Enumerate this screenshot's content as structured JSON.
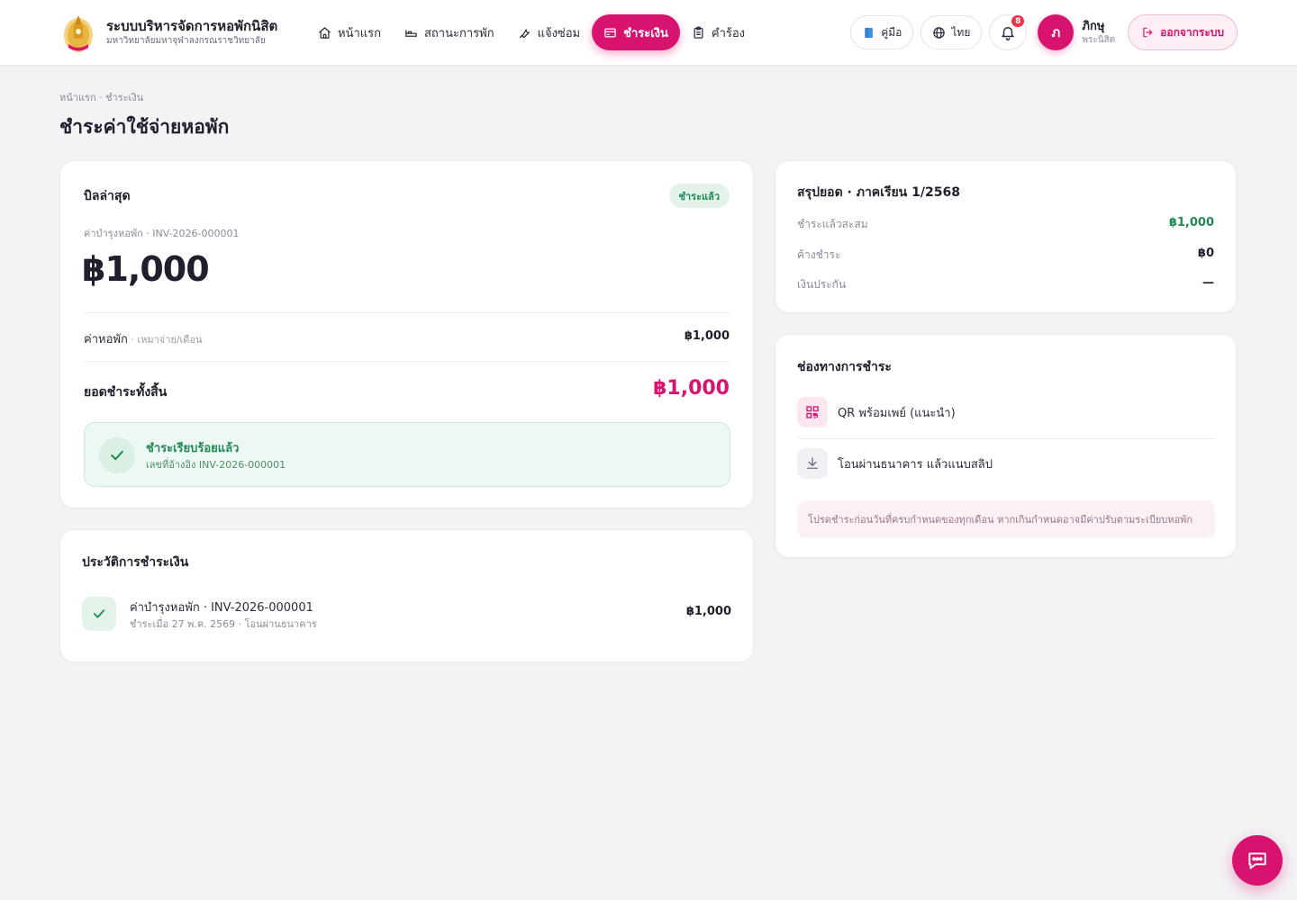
{
  "brand": {
    "title": "ระบบบริหารจัดการหอพักนิสิต",
    "subtitle": "มหาวิทยาลัยมหาจุฬาลงกรณราชวิทยาลัย"
  },
  "nav": {
    "items": [
      {
        "label": "หน้าแรก",
        "icon": "home-icon"
      },
      {
        "label": "สถานะการพัก",
        "icon": "bed-icon"
      },
      {
        "label": "แจ้งซ่อม",
        "icon": "wrench-icon"
      },
      {
        "label": "ชำระเงิน",
        "icon": "card-icon",
        "active": true
      },
      {
        "label": "คำร้อง",
        "icon": "clipboard-icon"
      }
    ]
  },
  "header": {
    "manual_label": "คู่มือ",
    "language_label": "ไทย",
    "notification_count": "8",
    "user_initial": "ภ",
    "user_name": "ภิกษุ",
    "user_role": "พระนิสิต",
    "logout_label": "ออกจากระบบ"
  },
  "page": {
    "breadcrumb": "หน้าแรก · ชำระเงิน",
    "title": "ชำระค่าใช้จ่ายหอพัก"
  },
  "bill": {
    "title": "บิลล่าสุด",
    "status": "ชำระแล้ว",
    "subtitle": "ค่าบำรุงหอพัก · INV-2026-000001",
    "amount": "฿1,000",
    "line_label": "ค่าหอพัก",
    "line_note": " · เหมาจ่าย/เดือน",
    "line_amount": "฿1,000",
    "total_label": "ยอดชำระทั้งสิ้น",
    "total_amount": "฿1,000",
    "success_title": "ชำระเรียบร้อยแล้ว",
    "success_ref": "เลขที่อ้างอิง INV-2026-000001"
  },
  "history": {
    "title": "ประวัติการชำระเงิน",
    "items": [
      {
        "title": "ค่าบำรุงหอพัก · INV-2026-000001",
        "subtitle": "ชำระเมื่อ 27 พ.ค. 2569 · โอนผ่านธนาคาร",
        "amount": "฿1,000"
      }
    ]
  },
  "summary": {
    "title": "สรุปยอด · ภาคเรียน 1/2568",
    "rows": [
      {
        "label": "ชำระแล้วสะสม",
        "value": "฿1,000"
      },
      {
        "label": "ค้างชำระ",
        "value": "฿0"
      },
      {
        "label": "เงินประกัน",
        "value": "—"
      }
    ]
  },
  "payment_channels": {
    "title": "ช่องทางการชำระ",
    "items": [
      {
        "label": "QR พร้อมเพย์ (แนะนำ)",
        "icon": "qr-code-icon"
      },
      {
        "label": "โอนผ่านธนาคาร แล้วแนบสลิป",
        "icon": "download-icon"
      }
    ],
    "note": "โปรดชำระก่อนวันที่ครบกำหนดของทุกเดือน หากเกินกำหนดอาจมีค่าปรับตามระเบียบหอพัก"
  },
  "colors": {
    "accent": "#d8136f",
    "success": "#1f8a55",
    "background": "#f3f3f6"
  }
}
